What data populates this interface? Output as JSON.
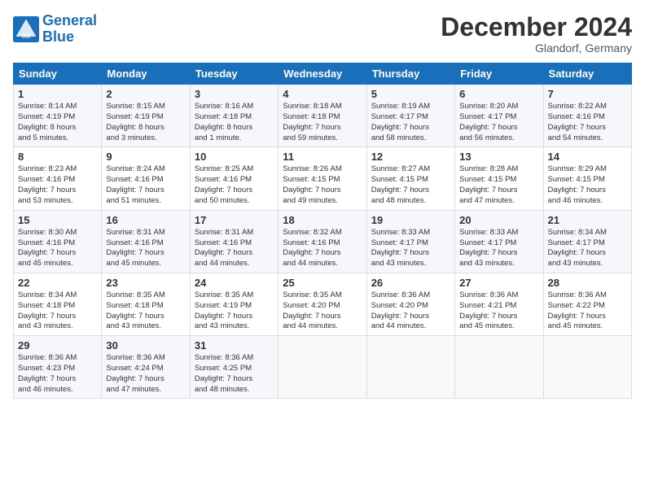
{
  "logo": {
    "line1": "General",
    "line2": "Blue"
  },
  "title": "December 2024",
  "location": "Glandorf, Germany",
  "days_header": [
    "Sunday",
    "Monday",
    "Tuesday",
    "Wednesday",
    "Thursday",
    "Friday",
    "Saturday"
  ],
  "weeks": [
    [
      {
        "day": "1",
        "info": "Sunrise: 8:14 AM\nSunset: 4:19 PM\nDaylight: 8 hours\nand 5 minutes."
      },
      {
        "day": "2",
        "info": "Sunrise: 8:15 AM\nSunset: 4:19 PM\nDaylight: 8 hours\nand 3 minutes."
      },
      {
        "day": "3",
        "info": "Sunrise: 8:16 AM\nSunset: 4:18 PM\nDaylight: 8 hours\nand 1 minute."
      },
      {
        "day": "4",
        "info": "Sunrise: 8:18 AM\nSunset: 4:18 PM\nDaylight: 7 hours\nand 59 minutes."
      },
      {
        "day": "5",
        "info": "Sunrise: 8:19 AM\nSunset: 4:17 PM\nDaylight: 7 hours\nand 58 minutes."
      },
      {
        "day": "6",
        "info": "Sunrise: 8:20 AM\nSunset: 4:17 PM\nDaylight: 7 hours\nand 56 minutes."
      },
      {
        "day": "7",
        "info": "Sunrise: 8:22 AM\nSunset: 4:16 PM\nDaylight: 7 hours\nand 54 minutes."
      }
    ],
    [
      {
        "day": "8",
        "info": "Sunrise: 8:23 AM\nSunset: 4:16 PM\nDaylight: 7 hours\nand 53 minutes."
      },
      {
        "day": "9",
        "info": "Sunrise: 8:24 AM\nSunset: 4:16 PM\nDaylight: 7 hours\nand 51 minutes."
      },
      {
        "day": "10",
        "info": "Sunrise: 8:25 AM\nSunset: 4:16 PM\nDaylight: 7 hours\nand 50 minutes."
      },
      {
        "day": "11",
        "info": "Sunrise: 8:26 AM\nSunset: 4:15 PM\nDaylight: 7 hours\nand 49 minutes."
      },
      {
        "day": "12",
        "info": "Sunrise: 8:27 AM\nSunset: 4:15 PM\nDaylight: 7 hours\nand 48 minutes."
      },
      {
        "day": "13",
        "info": "Sunrise: 8:28 AM\nSunset: 4:15 PM\nDaylight: 7 hours\nand 47 minutes."
      },
      {
        "day": "14",
        "info": "Sunrise: 8:29 AM\nSunset: 4:15 PM\nDaylight: 7 hours\nand 46 minutes."
      }
    ],
    [
      {
        "day": "15",
        "info": "Sunrise: 8:30 AM\nSunset: 4:16 PM\nDaylight: 7 hours\nand 45 minutes."
      },
      {
        "day": "16",
        "info": "Sunrise: 8:31 AM\nSunset: 4:16 PM\nDaylight: 7 hours\nand 45 minutes."
      },
      {
        "day": "17",
        "info": "Sunrise: 8:31 AM\nSunset: 4:16 PM\nDaylight: 7 hours\nand 44 minutes."
      },
      {
        "day": "18",
        "info": "Sunrise: 8:32 AM\nSunset: 4:16 PM\nDaylight: 7 hours\nand 44 minutes."
      },
      {
        "day": "19",
        "info": "Sunrise: 8:33 AM\nSunset: 4:17 PM\nDaylight: 7 hours\nand 43 minutes."
      },
      {
        "day": "20",
        "info": "Sunrise: 8:33 AM\nSunset: 4:17 PM\nDaylight: 7 hours\nand 43 minutes."
      },
      {
        "day": "21",
        "info": "Sunrise: 8:34 AM\nSunset: 4:17 PM\nDaylight: 7 hours\nand 43 minutes."
      }
    ],
    [
      {
        "day": "22",
        "info": "Sunrise: 8:34 AM\nSunset: 4:18 PM\nDaylight: 7 hours\nand 43 minutes."
      },
      {
        "day": "23",
        "info": "Sunrise: 8:35 AM\nSunset: 4:18 PM\nDaylight: 7 hours\nand 43 minutes."
      },
      {
        "day": "24",
        "info": "Sunrise: 8:35 AM\nSunset: 4:19 PM\nDaylight: 7 hours\nand 43 minutes."
      },
      {
        "day": "25",
        "info": "Sunrise: 8:35 AM\nSunset: 4:20 PM\nDaylight: 7 hours\nand 44 minutes."
      },
      {
        "day": "26",
        "info": "Sunrise: 8:36 AM\nSunset: 4:20 PM\nDaylight: 7 hours\nand 44 minutes."
      },
      {
        "day": "27",
        "info": "Sunrise: 8:36 AM\nSunset: 4:21 PM\nDaylight: 7 hours\nand 45 minutes."
      },
      {
        "day": "28",
        "info": "Sunrise: 8:36 AM\nSunset: 4:22 PM\nDaylight: 7 hours\nand 45 minutes."
      }
    ],
    [
      {
        "day": "29",
        "info": "Sunrise: 8:36 AM\nSunset: 4:23 PM\nDaylight: 7 hours\nand 46 minutes."
      },
      {
        "day": "30",
        "info": "Sunrise: 8:36 AM\nSunset: 4:24 PM\nDaylight: 7 hours\nand 47 minutes."
      },
      {
        "day": "31",
        "info": "Sunrise: 8:36 AM\nSunset: 4:25 PM\nDaylight: 7 hours\nand 48 minutes."
      },
      null,
      null,
      null,
      null
    ]
  ]
}
